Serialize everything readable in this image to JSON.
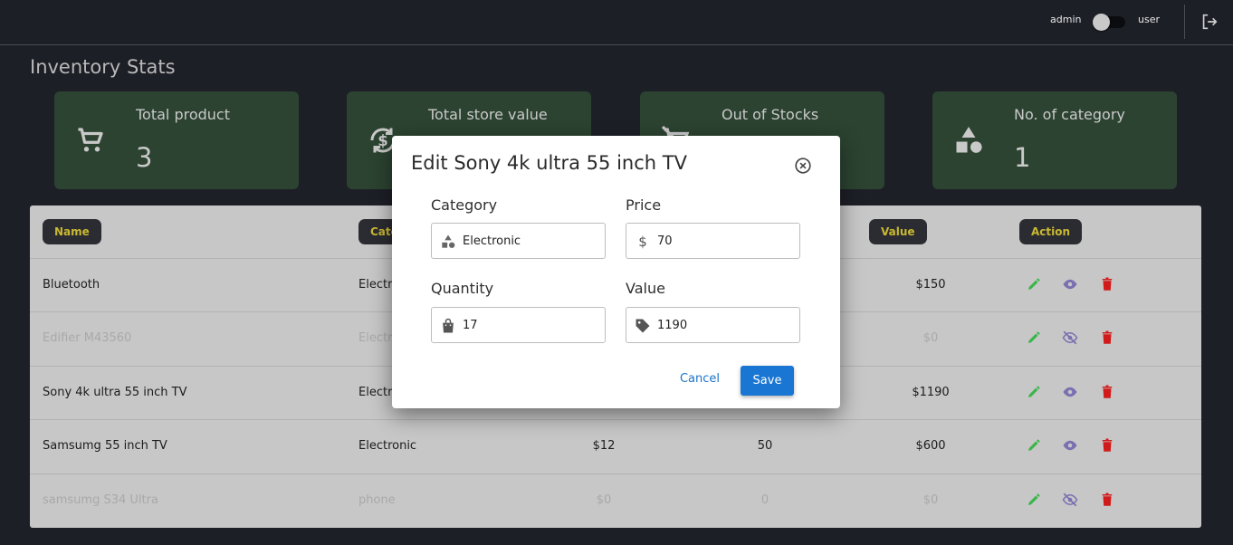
{
  "topbar": {
    "role_left": "admin",
    "role_right": "user"
  },
  "page_title": "Inventory Stats",
  "stats": [
    {
      "label": "Total product",
      "value": "3"
    },
    {
      "label": "Total store value",
      "value": ""
    },
    {
      "label": "Out of Stocks",
      "value": ""
    },
    {
      "label": "No. of category",
      "value": "1"
    }
  ],
  "table": {
    "headers": [
      "Name",
      "Category",
      "Value",
      "Action"
    ],
    "rows": [
      {
        "name": "Bluetooth",
        "category": "Electronic",
        "price": "",
        "quantity": "",
        "value": "$150",
        "disabled": false
      },
      {
        "name": "Edifier M43560",
        "category": "Electronic",
        "price": "",
        "quantity": "",
        "value": "$0",
        "disabled": true
      },
      {
        "name": "Sony 4k ultra 55 inch TV",
        "category": "Electronic",
        "price": "",
        "quantity": "",
        "value": "$1190",
        "disabled": false
      },
      {
        "name": "Samsumg 55 inch TV",
        "category": "Electronic",
        "price": "$12",
        "quantity": "50",
        "value": "$600",
        "disabled": false
      },
      {
        "name": "samsumg S34 Ultra",
        "category": "phone",
        "price": "$0",
        "quantity": "0",
        "value": "$0",
        "disabled": true
      }
    ]
  },
  "modal": {
    "title": "Edit Sony 4k ultra 55 inch TV",
    "category_label": "Category",
    "category_value": "Electronic",
    "price_label": "Price",
    "price_value": "70",
    "quantity_label": "Quantity",
    "quantity_value": "17",
    "value_label": "Value",
    "value_value": "1190",
    "cancel_label": "Cancel",
    "save_label": "Save"
  },
  "colors": {
    "card_bg": "#2c4331",
    "header_pill_text": "#c9b832",
    "primary": "#1976d2",
    "edit": "#3bb54a",
    "view": "#7a6fb0",
    "delete": "#d11a1a"
  }
}
